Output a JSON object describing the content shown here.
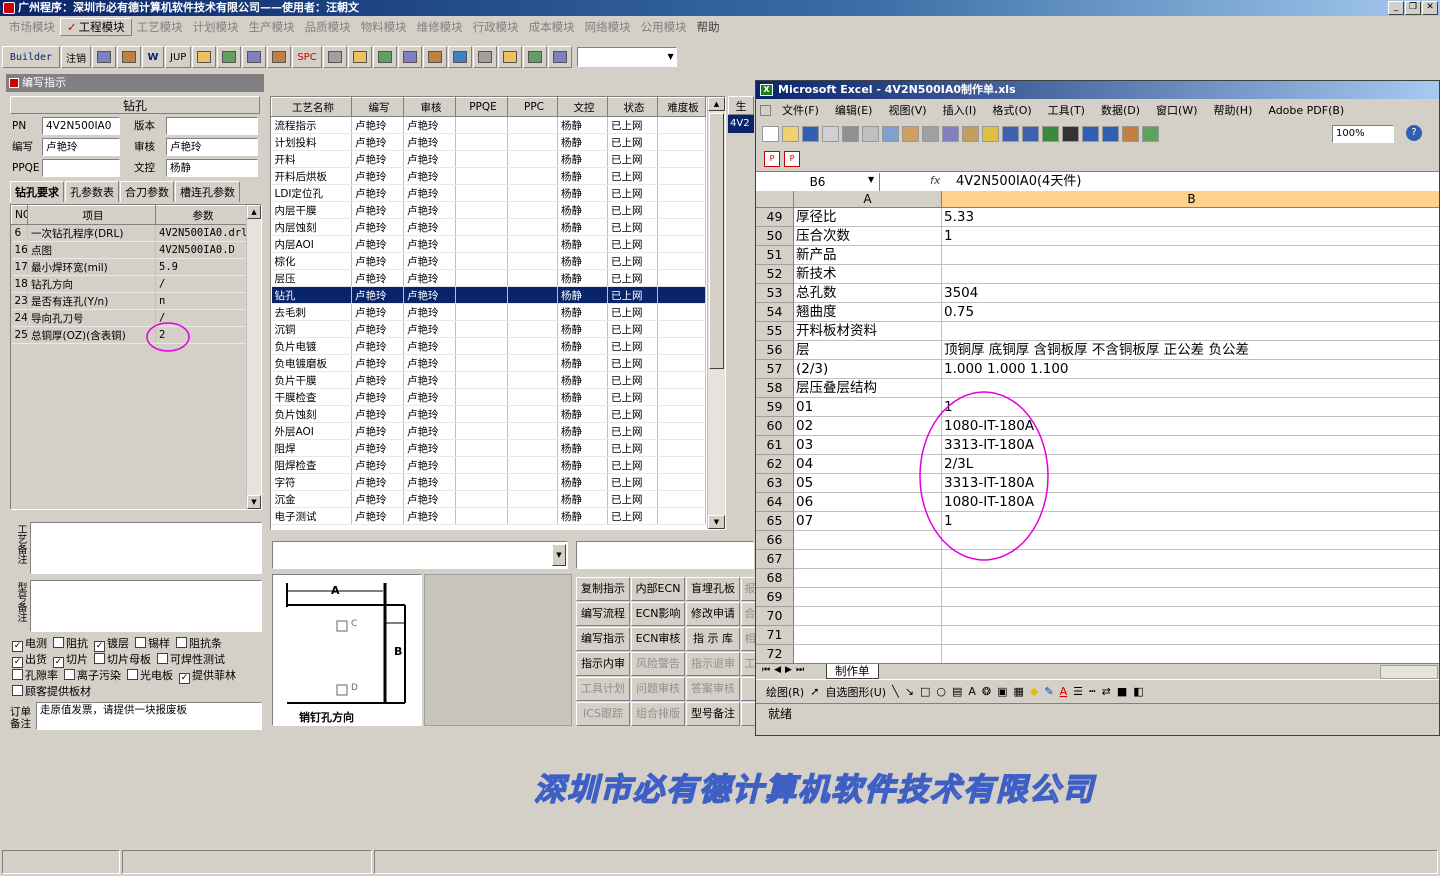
{
  "app": {
    "title": "广州程序：深圳市必有德计算机软件技术有限公司——使用者：汪朝文",
    "menus": [
      "市场模块",
      "工程模块",
      "工艺模块",
      "计划模块",
      "生产模块",
      "品质模块",
      "物料模块",
      "维修模块",
      "行政模块",
      "成本模块",
      "网络模块",
      "公用模块",
      "帮助"
    ],
    "active_menu": "工程模块"
  },
  "toolbar": {
    "items": [
      "Builder",
      "注销",
      "",
      "",
      "W",
      "JUP",
      "",
      "",
      "",
      "",
      "SPC",
      "",
      "",
      "",
      "",
      "",
      "",
      "",
      "",
      "",
      ""
    ]
  },
  "editor": {
    "title": "编写指示",
    "process": "钻孔",
    "pn_label": "PN",
    "pn": "4V2N500IA0",
    "version_label": "版本",
    "version": "",
    "writer_label": "编写",
    "writer": "卢艳玲",
    "reviewer_label": "审核",
    "reviewer": "卢艳玲",
    "ppqe_label": "PPQE",
    "ppqe": "",
    "control_label": "文控",
    "control": "杨静",
    "tabs": [
      "钻孔要求",
      "孔参数表",
      "合刀参数",
      "槽连孔参数"
    ],
    "params_headers": [
      "NO",
      "项目",
      "参数"
    ],
    "params": [
      {
        "no": "6",
        "item": "一次钻孔程序(DRL)",
        "value": "4V2N500IA0.drl"
      },
      {
        "no": "16",
        "item": "点图",
        "value": "4V2N500IA0.D"
      },
      {
        "no": "17",
        "item": "最小焊环宽(mil)",
        "value": "5.9"
      },
      {
        "no": "18",
        "item": "钻孔方向",
        "value": "/"
      },
      {
        "no": "23",
        "item": "是否有连孔(Y/n)",
        "value": "n"
      },
      {
        "no": "24",
        "item": "导向孔刀号",
        "value": "/"
      },
      {
        "no": "25",
        "item": "总铜厚(OZ)(含表铜)",
        "value": "2"
      }
    ],
    "process_note_label": "工艺备注",
    "model_note_label": "型号备注",
    "order_note_label": "订单备注",
    "order_note": "走原值发票，请提供一块报废板",
    "checks": [
      {
        "label": "电测",
        "checked": true
      },
      {
        "label": "阻抗",
        "checked": false
      },
      {
        "label": "镀层",
        "checked": true
      },
      {
        "label": "锡样",
        "checked": false
      },
      {
        "label": "阻抗条",
        "checked": false
      },
      {
        "label": "出货",
        "checked": true
      },
      {
        "label": "切片",
        "checked": true
      },
      {
        "label": "切片母板",
        "checked": false
      },
      {
        "label": "可焊性测试",
        "checked": false
      },
      {
        "label": "孔隙率",
        "checked": false
      },
      {
        "label": "离子污染",
        "checked": false
      },
      {
        "label": "光电板",
        "checked": false
      },
      {
        "label": "提供菲林",
        "checked": true
      },
      {
        "label": "顾客提供板材",
        "checked": false
      }
    ]
  },
  "process_list": {
    "headers": [
      "工艺名称",
      "编写",
      "审核",
      "PPQE",
      "PPC",
      "文控",
      "状态",
      "难度板"
    ],
    "extra_col": "生",
    "extra_val": "4V2",
    "rows": [
      [
        "流程指示",
        "卢艳玲",
        "卢艳玲",
        "",
        "",
        "杨静",
        "已上网",
        ""
      ],
      [
        "计划投料",
        "卢艳玲",
        "卢艳玲",
        "",
        "",
        "杨静",
        "已上网",
        ""
      ],
      [
        "开料",
        "卢艳玲",
        "卢艳玲",
        "",
        "",
        "杨静",
        "已上网",
        ""
      ],
      [
        "开料后烘板",
        "卢艳玲",
        "卢艳玲",
        "",
        "",
        "杨静",
        "已上网",
        ""
      ],
      [
        "LDI定位孔",
        "卢艳玲",
        "卢艳玲",
        "",
        "",
        "杨静",
        "已上网",
        ""
      ],
      [
        "内层干膜",
        "卢艳玲",
        "卢艳玲",
        "",
        "",
        "杨静",
        "已上网",
        ""
      ],
      [
        "内层蚀刻",
        "卢艳玲",
        "卢艳玲",
        "",
        "",
        "杨静",
        "已上网",
        ""
      ],
      [
        "内层AOI",
        "卢艳玲",
        "卢艳玲",
        "",
        "",
        "杨静",
        "已上网",
        ""
      ],
      [
        "棕化",
        "卢艳玲",
        "卢艳玲",
        "",
        "",
        "杨静",
        "已上网",
        ""
      ],
      [
        "层压",
        "卢艳玲",
        "卢艳玲",
        "",
        "",
        "杨静",
        "已上网",
        ""
      ],
      [
        "钻孔",
        "卢艳玲",
        "卢艳玲",
        "",
        "",
        "杨静",
        "已上网",
        ""
      ],
      [
        "去毛刺",
        "卢艳玲",
        "卢艳玲",
        "",
        "",
        "杨静",
        "已上网",
        ""
      ],
      [
        "沉铜",
        "卢艳玲",
        "卢艳玲",
        "",
        "",
        "杨静",
        "已上网",
        ""
      ],
      [
        "负片电镀",
        "卢艳玲",
        "卢艳玲",
        "",
        "",
        "杨静",
        "已上网",
        ""
      ],
      [
        "负电镀磨板",
        "卢艳玲",
        "卢艳玲",
        "",
        "",
        "杨静",
        "已上网",
        ""
      ],
      [
        "负片干膜",
        "卢艳玲",
        "卢艳玲",
        "",
        "",
        "杨静",
        "已上网",
        ""
      ],
      [
        "干膜检查",
        "卢艳玲",
        "卢艳玲",
        "",
        "",
        "杨静",
        "已上网",
        ""
      ],
      [
        "负片蚀刻",
        "卢艳玲",
        "卢艳玲",
        "",
        "",
        "杨静",
        "已上网",
        ""
      ],
      [
        "外层AOI",
        "卢艳玲",
        "卢艳玲",
        "",
        "",
        "杨静",
        "已上网",
        ""
      ],
      [
        "阻焊",
        "卢艳玲",
        "卢艳玲",
        "",
        "",
        "杨静",
        "已上网",
        ""
      ],
      [
        "阻焊检查",
        "卢艳玲",
        "卢艳玲",
        "",
        "",
        "杨静",
        "已上网",
        ""
      ],
      [
        "字符",
        "卢艳玲",
        "卢艳玲",
        "",
        "",
        "杨静",
        "已上网",
        ""
      ],
      [
        "沉金",
        "卢艳玲",
        "卢艳玲",
        "",
        "",
        "杨静",
        "已上网",
        ""
      ],
      [
        "电子测试",
        "卢艳玲",
        "卢艳玲",
        "",
        "",
        "杨静",
        "已上网",
        ""
      ]
    ],
    "selected": "钻孔"
  },
  "pin_diagram": {
    "a": "A",
    "b": "B",
    "c": "C",
    "d": "D",
    "caption": "销钉孔方向"
  },
  "actions": [
    {
      "label": "复制指示",
      "enabled": true
    },
    {
      "label": "内部ECN",
      "enabled": true
    },
    {
      "label": "盲埋孔板",
      "enabled": true
    },
    {
      "label": "报",
      "enabled": false
    },
    {
      "label": "编写流程",
      "enabled": true
    },
    {
      "label": "ECN影响",
      "enabled": true
    },
    {
      "label": "修改申请",
      "enabled": true
    },
    {
      "label": "合",
      "enabled": false
    },
    {
      "label": "编写指示",
      "enabled": true
    },
    {
      "label": "ECN审核",
      "enabled": true
    },
    {
      "label": "指 示 库",
      "enabled": true
    },
    {
      "label": "相",
      "enabled": false
    },
    {
      "label": "指示内审",
      "enabled": true
    },
    {
      "label": "风险警告",
      "enabled": false
    },
    {
      "label": "指示退审",
      "enabled": false
    },
    {
      "label": "工",
      "enabled": false
    },
    {
      "label": "工具计划",
      "enabled": false
    },
    {
      "label": "问题审核",
      "enabled": false
    },
    {
      "label": "答案审核",
      "enabled": false
    },
    {
      "label": "",
      "enabled": false
    },
    {
      "label": "ICS跟踪",
      "enabled": false
    },
    {
      "label": "组合排版",
      "enabled": false
    },
    {
      "label": "型号备注",
      "enabled": true
    },
    {
      "label": "",
      "enabled": false
    }
  ],
  "excel": {
    "title": "Microsoft Excel - 4V2N500IA0制作单.xls",
    "menus": [
      "文件(F)",
      "编辑(E)",
      "视图(V)",
      "插入(I)",
      "格式(O)",
      "工具(T)",
      "数据(D)",
      "窗口(W)",
      "帮助(H)",
      "Adobe PDF(B)"
    ],
    "zoom": "100%",
    "name_box": "B6",
    "fx": "fx",
    "formula": "4V2N500IA0(4天件)",
    "col_a": "A",
    "col_b": "B",
    "sheet": "制作单",
    "status": "就绪",
    "draw_label": "绘图(R)",
    "autoshape_label": "自选图形(U)",
    "rows": [
      {
        "n": "49",
        "a": "厚径比",
        "b": "5.33"
      },
      {
        "n": "50",
        "a": "压合次数",
        "b": "1"
      },
      {
        "n": "51",
        "a": "新产品",
        "b": ""
      },
      {
        "n": "52",
        "a": "新技术",
        "b": ""
      },
      {
        "n": "53",
        "a": "总孔数",
        "b": "3504"
      },
      {
        "n": "54",
        "a": "翘曲度",
        "b": "0.75"
      },
      {
        "n": "55",
        "a": "开料板材资料",
        "b": ""
      },
      {
        "n": "56",
        "a": "层",
        "b": "顶铜厚 底铜厚 含铜板厚 不含铜板厚 正公差 负公差"
      },
      {
        "n": "57",
        "a": "(2/3)",
        "b": "1.000  1.000   1.100"
      },
      {
        "n": "58",
        "a": "层压叠层结构",
        "b": ""
      },
      {
        "n": "59",
        "a": "01",
        "b": "1"
      },
      {
        "n": "60",
        "a": "02",
        "b": "1080-IT-180A"
      },
      {
        "n": "61",
        "a": "03",
        "b": "3313-IT-180A"
      },
      {
        "n": "62",
        "a": "04",
        "b": "2/3L"
      },
      {
        "n": "63",
        "a": "05",
        "b": "3313-IT-180A"
      },
      {
        "n": "64",
        "a": "06",
        "b": "1080-IT-180A"
      },
      {
        "n": "65",
        "a": "07",
        "b": "1"
      },
      {
        "n": "66",
        "a": "",
        "b": ""
      },
      {
        "n": "67",
        "a": "",
        "b": ""
      },
      {
        "n": "68",
        "a": "",
        "b": ""
      },
      {
        "n": "69",
        "a": "",
        "b": ""
      },
      {
        "n": "70",
        "a": "",
        "b": ""
      },
      {
        "n": "71",
        "a": "",
        "b": ""
      },
      {
        "n": "72",
        "a": "",
        "b": ""
      }
    ]
  },
  "watermark": "深圳市必有德计算机软件技术有限公司",
  "colors": {
    "title_blue": "#0a246a",
    "highlight": "#e000e0",
    "watermark": "#3e5fc4"
  }
}
